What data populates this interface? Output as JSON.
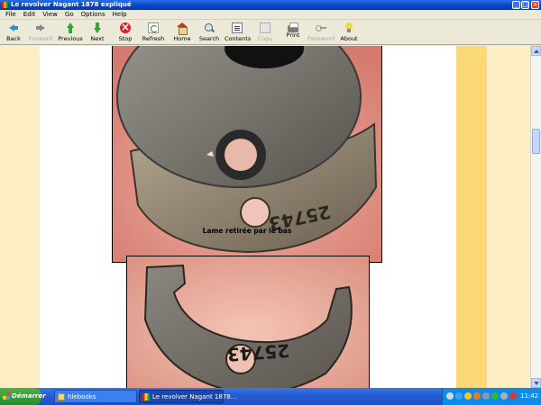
{
  "window": {
    "title": "Le revolver Nagant 1878 expliqué"
  },
  "menu": [
    "File",
    "Edit",
    "View",
    "Go",
    "Options",
    "Help"
  ],
  "toolbar": [
    {
      "label": "Back",
      "icon": "back-arrow-icon",
      "enabled": true
    },
    {
      "label": "Forward",
      "icon": "forward-arrow-icon",
      "enabled": false
    },
    {
      "label": "Previous",
      "icon": "previous-arrow-icon",
      "enabled": true
    },
    {
      "label": "Next",
      "icon": "next-arrow-icon",
      "enabled": true
    },
    {
      "label": "Stop",
      "icon": "stop-icon",
      "enabled": true
    },
    {
      "label": "Refresh",
      "icon": "refresh-icon",
      "enabled": true
    },
    {
      "label": "Home",
      "icon": "home-icon",
      "enabled": true
    },
    {
      "label": "Search",
      "icon": "search-icon",
      "enabled": true
    },
    {
      "label": "Contents",
      "icon": "contents-icon",
      "enabled": true
    },
    {
      "label": "Copy",
      "icon": "copy-icon",
      "enabled": false
    },
    {
      "label": "Print",
      "icon": "print-icon",
      "enabled": true
    },
    {
      "label": "Password",
      "icon": "password-key-icon",
      "enabled": false
    },
    {
      "label": "About",
      "icon": "about-bulb-icon",
      "enabled": true
    }
  ],
  "content": {
    "caption": "Lame retirée par le bas",
    "photo1_marking": "25743",
    "photo2_marking": "25743"
  },
  "taskbar": {
    "start_label": "Démarrer",
    "tasks": [
      {
        "label": "hlebooks"
      },
      {
        "label": "Le revolver Nagant 1878..."
      }
    ],
    "clock": "11:42"
  },
  "colors": {
    "page_background": "#ffffff",
    "side_band": "#fdeec4",
    "accent_band": "#fbd878",
    "titlebar": "#0a46c8"
  }
}
